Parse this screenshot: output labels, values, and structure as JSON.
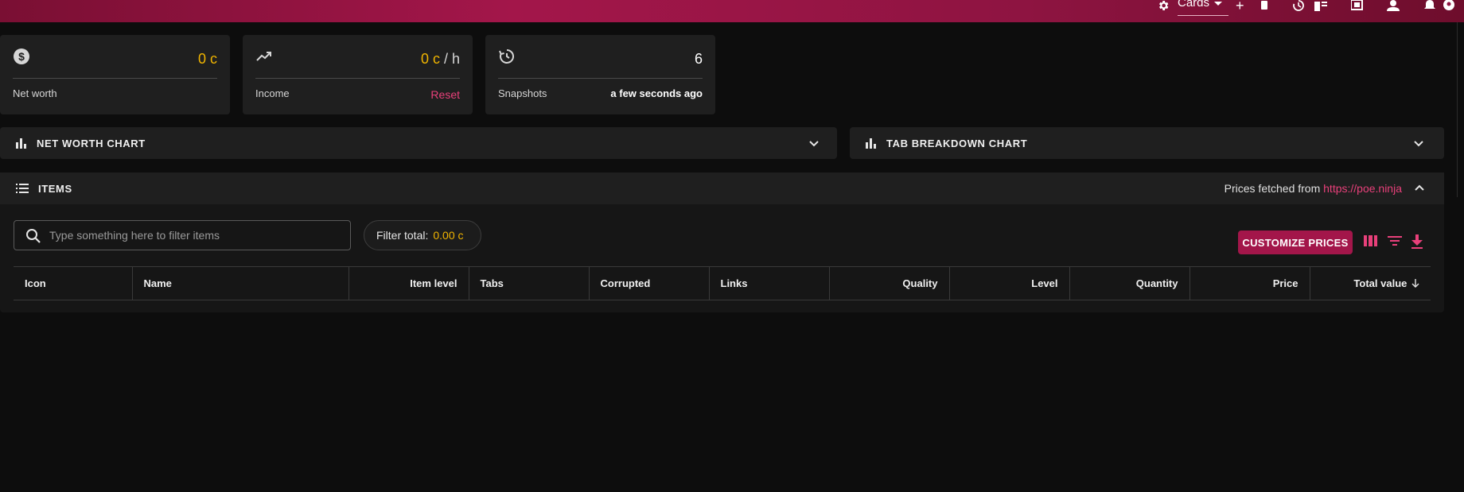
{
  "topbar": {
    "profile_label": "Cards",
    "icons": [
      "settings-icon",
      "add-icon",
      "clipboard-icon",
      "history-icon",
      "snapshot-list-icon",
      "library-icon",
      "group-icon",
      "notifications-icon",
      "account-icon"
    ]
  },
  "stats": {
    "net_worth": {
      "value": "0 c",
      "label": "Net worth",
      "icon": "dollar-icon"
    },
    "income": {
      "value": "0 c",
      "unit": " / h",
      "label": "Income",
      "action": "Reset",
      "icon": "trending-up-icon"
    },
    "snapshots": {
      "value": "6",
      "label": "Snapshots",
      "time": "a few seconds ago",
      "icon": "history-icon"
    }
  },
  "charts": {
    "net_worth_title": "NET WORTH CHART",
    "tab_breakdown_title": "TAB BREAKDOWN CHART"
  },
  "items": {
    "title": "ITEMS",
    "prices_from_text": "Prices fetched from ",
    "prices_from_link": "https://poe.ninja",
    "search_placeholder": "Type something here to filter items",
    "filter_total_label": "Filter total:",
    "filter_total_value": "0.00 c",
    "customize_label": "CUSTOMIZE PRICES",
    "columns": [
      "Icon",
      "Name",
      "Item level",
      "Tabs",
      "Corrupted",
      "Links",
      "Quality",
      "Level",
      "Quantity",
      "Price",
      "Total value"
    ]
  },
  "colors": {
    "accent": "#a3164a",
    "link": "#e8407a",
    "currency": "#f0b400",
    "card_bg": "#1f1f1f",
    "page_bg": "#0d0d0d"
  }
}
